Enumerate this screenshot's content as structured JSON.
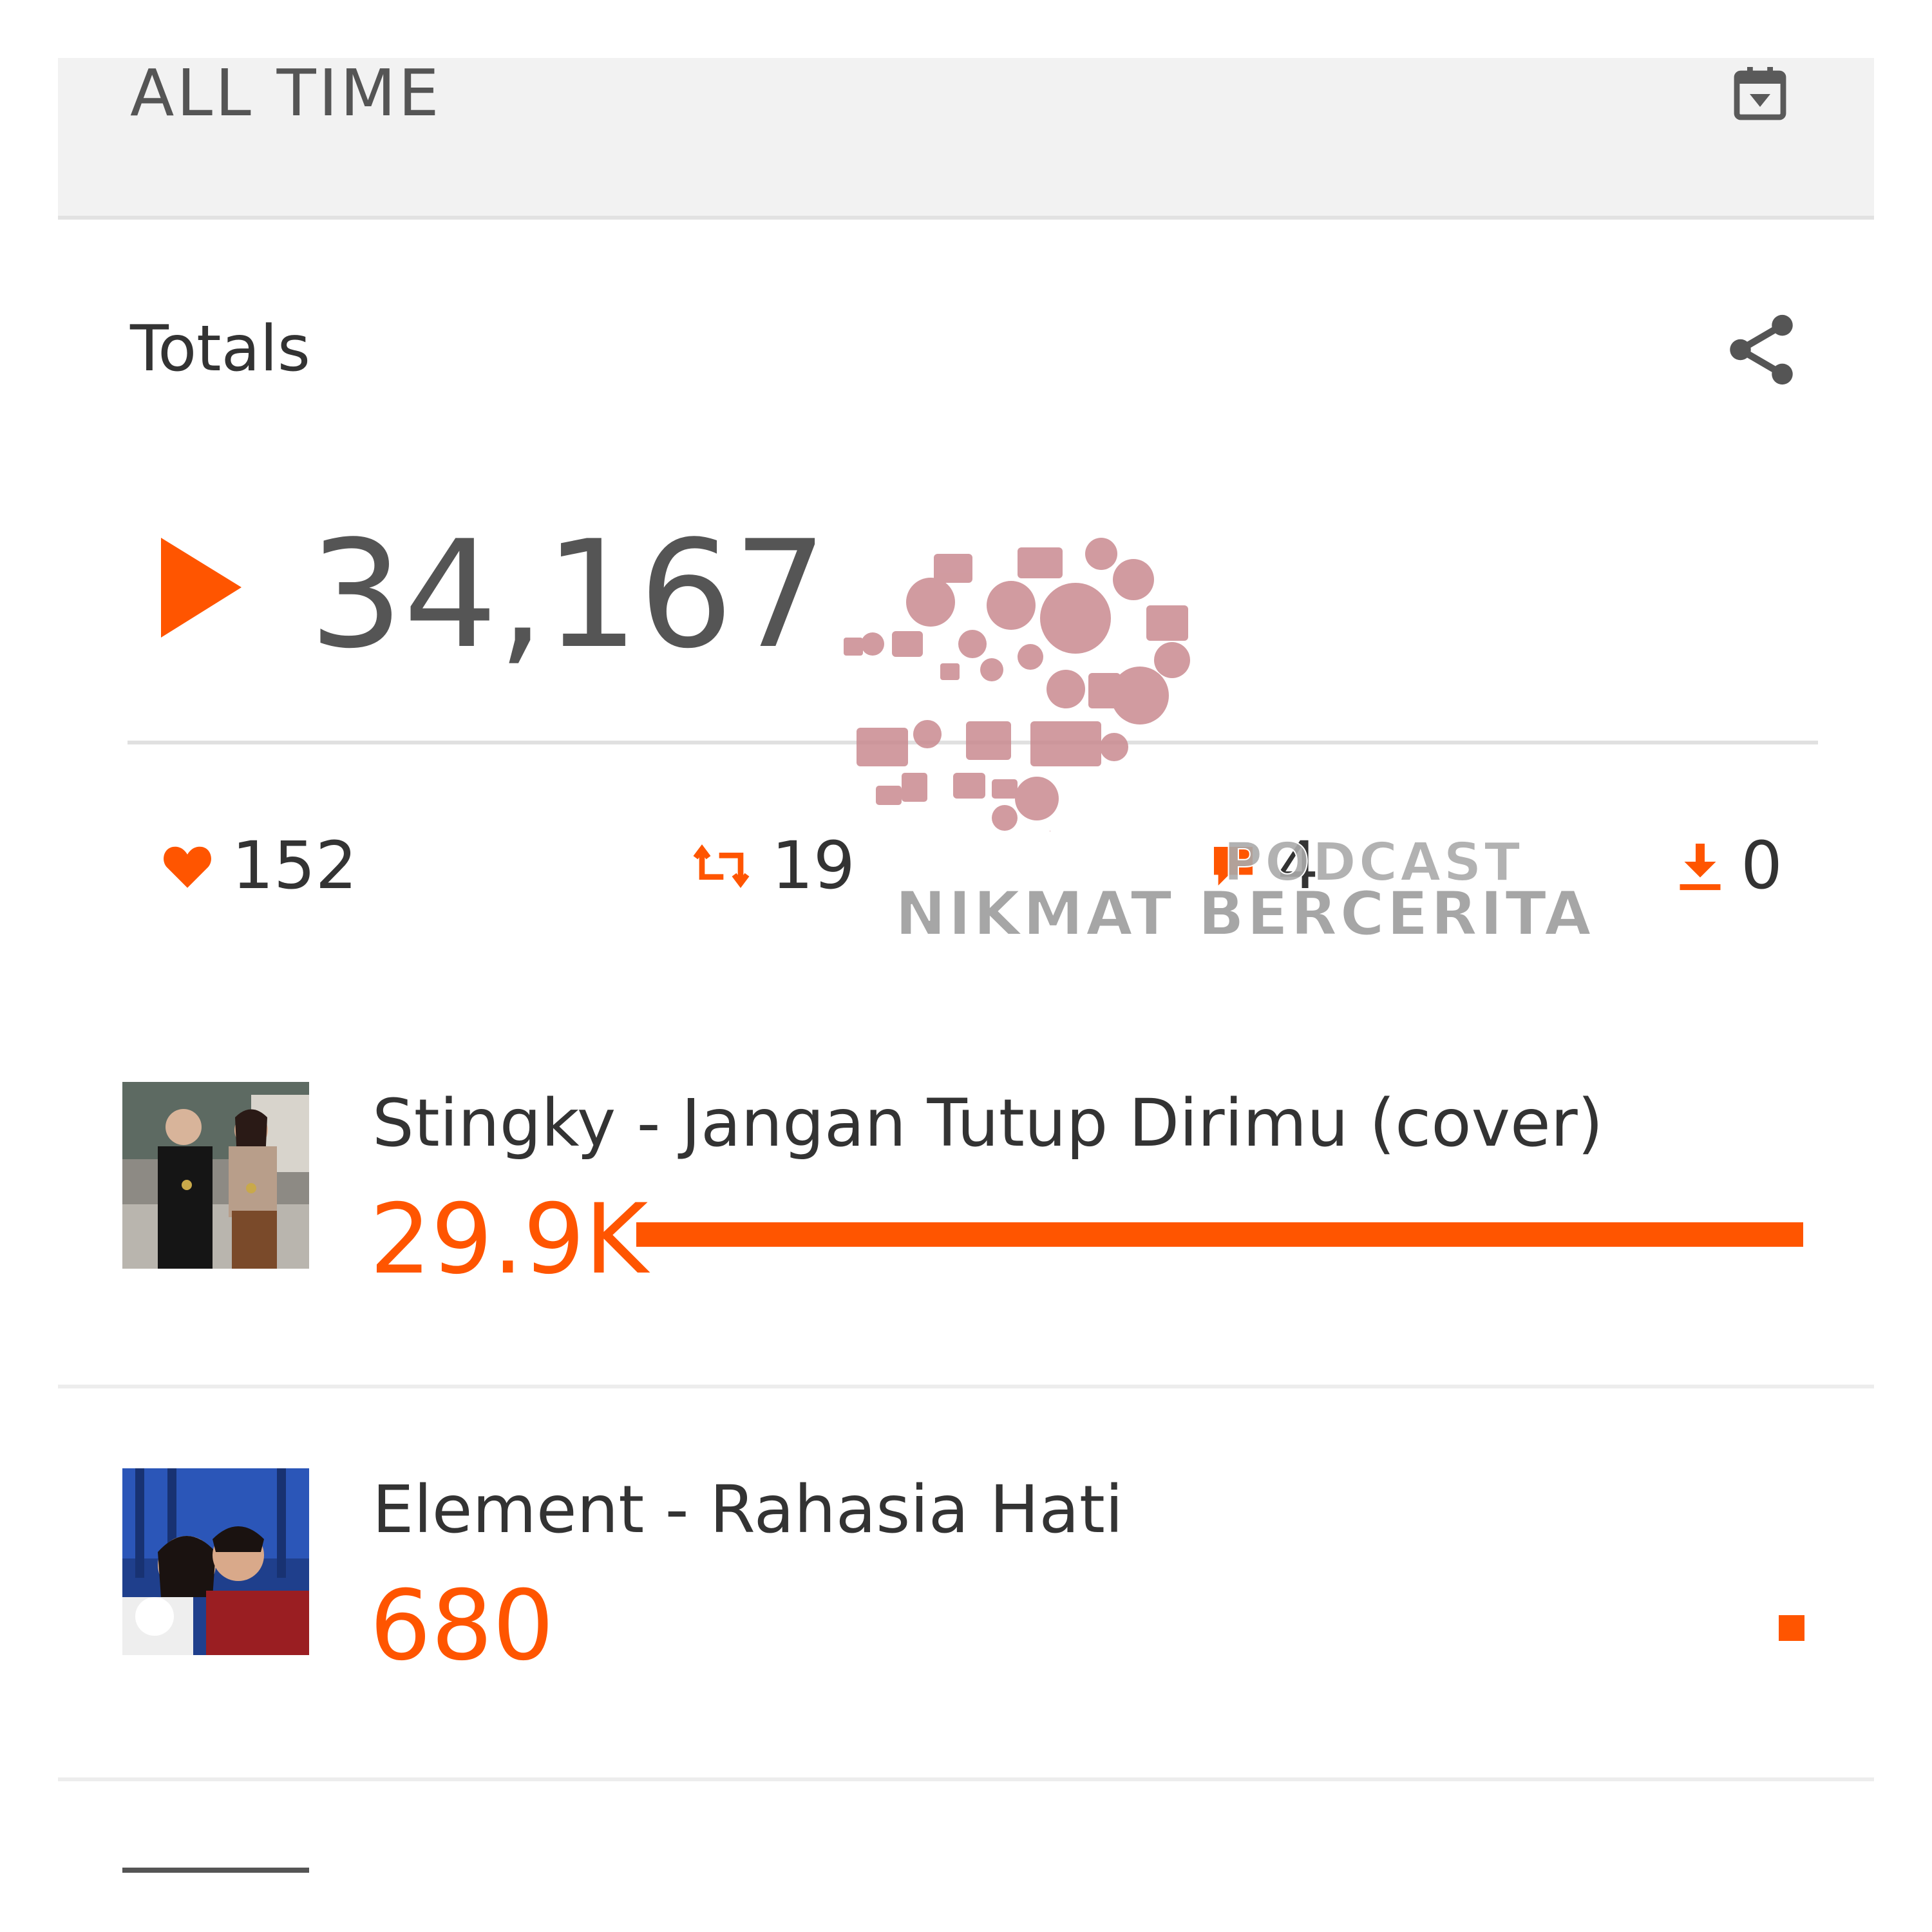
{
  "range": {
    "label": "ALL TIME"
  },
  "totals": {
    "title": "Totals",
    "plays": "34,167",
    "likes": "152",
    "reposts": "19",
    "comments": "4",
    "downloads": "0"
  },
  "watermark": {
    "line1": "PODCAST",
    "line2": "NIKMAT BERCERITA"
  },
  "tracks": [
    {
      "title": "Stingky - Jangan Tutup Dirimu (cover)",
      "plays": "29.9K",
      "share_of_max": 1.0
    },
    {
      "title": "Element - Rahasia Hati",
      "plays": "680",
      "share_of_max": 0.023
    }
  ],
  "colors": {
    "accent": "#ff5500",
    "text": "#333333",
    "muted": "#555555",
    "header_bg": "#f2f2f2"
  },
  "icons": [
    "calendar-icon",
    "share-icon",
    "play-icon",
    "heart-icon",
    "repost-icon",
    "comment-icon",
    "download-icon"
  ]
}
